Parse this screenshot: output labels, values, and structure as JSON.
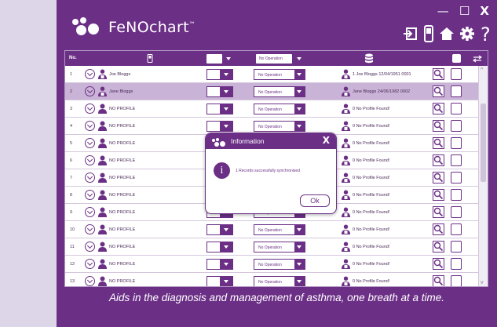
{
  "app": {
    "brand": "FeNOchart",
    "trademark": "™",
    "tagline": "Aids in the diagnosis and management of asthma, one breath at a time."
  },
  "window_controls": {
    "minimize": "—",
    "maximize": "☐",
    "close": "X"
  },
  "header_icons": [
    "exit-icon",
    "device-icon",
    "home-icon",
    "settings-icon",
    "help-icon"
  ],
  "table": {
    "header": {
      "no": "No.",
      "operation_filter": "No Operation"
    },
    "rows": [
      {
        "num": "1",
        "name": "Joe Bloggs",
        "operation": "No Operation",
        "profile": "1 Joe Bloggs 12/04/1951 0001",
        "selected": false
      },
      {
        "num": "2",
        "name": "Jane Bloggs",
        "operation": "No Operation",
        "profile": "Jane Bloggs 24/06/1982 0002",
        "selected": true
      },
      {
        "num": "3",
        "name": "NO PROFILE",
        "operation": "No Operation",
        "profile": "0 No Profile Found!",
        "selected": false
      },
      {
        "num": "4",
        "name": "NO PROFILE",
        "operation": "No Operation",
        "profile": "0 No Profile Found!",
        "selected": false
      },
      {
        "num": "5",
        "name": "NO PROFILE",
        "operation": "No Operation",
        "profile": "0 No Profile Found!",
        "selected": false
      },
      {
        "num": "6",
        "name": "NO PROFILE",
        "operation": "No Operation",
        "profile": "0 No Profile Found!",
        "selected": false
      },
      {
        "num": "7",
        "name": "NO PROFILE",
        "operation": "No Operation",
        "profile": "0 No Profile Found!",
        "selected": false
      },
      {
        "num": "8",
        "name": "NO PROFILE",
        "operation": "No Operation",
        "profile": "0 No Profile Found!",
        "selected": false
      },
      {
        "num": "9",
        "name": "NO PROFILE",
        "operation": "No Operation",
        "profile": "0 No Profile Found!",
        "selected": false
      },
      {
        "num": "10",
        "name": "NO PROFILE",
        "operation": "No Operation",
        "profile": "0 No Profile Found!",
        "selected": false
      },
      {
        "num": "11",
        "name": "NO PROFILE",
        "operation": "No Operation",
        "profile": "0 No Profile Found!",
        "selected": false
      },
      {
        "num": "12",
        "name": "NO PROFILE",
        "operation": "No Operation",
        "profile": "0 No Profile Found!",
        "selected": false
      },
      {
        "num": "13",
        "name": "NO PROFILE",
        "operation": "No Operation",
        "profile": "0 No Profile Found!",
        "selected": false
      }
    ]
  },
  "dialog": {
    "title": "Information",
    "close": "X",
    "icon": "info-icon",
    "message": "1 Records successfully synchronised",
    "ok_label": "Ok"
  },
  "colors": {
    "brand_purple": "#6b2f86",
    "background": "#ddd6e8",
    "selected_row": "#c9b3d6"
  }
}
